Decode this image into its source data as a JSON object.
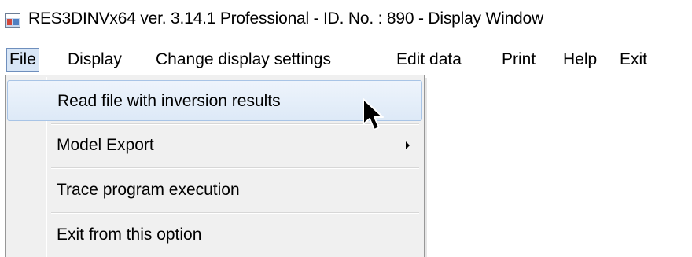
{
  "window": {
    "title": "RES3DINVx64 ver. 3.14.1 Professional - ID. No. : 890  - Display Window",
    "icon": "app-window-icon"
  },
  "menubar": {
    "items": [
      {
        "label": "File",
        "active": true
      },
      {
        "label": "Display",
        "active": false
      },
      {
        "label": "Change display settings",
        "active": false
      },
      {
        "label": "Edit data",
        "active": false
      },
      {
        "label": "Print",
        "active": false
      },
      {
        "label": "Help",
        "active": false
      },
      {
        "label": "Exit",
        "active": false
      }
    ]
  },
  "file_menu": {
    "items": [
      {
        "label": "Read file with inversion results",
        "highlighted": true,
        "has_submenu": false
      },
      {
        "label": "Model Export",
        "highlighted": false,
        "has_submenu": true
      },
      {
        "label": "Trace program execution",
        "highlighted": false,
        "has_submenu": false
      },
      {
        "label": "Exit from this option",
        "highlighted": false,
        "has_submenu": false
      }
    ]
  },
  "colors": {
    "menu_active_bg": "#d8e6f6",
    "menu_active_border": "#6f8fbd",
    "dropdown_bg": "#f0f0f0",
    "highlight_border": "#a8c4e6"
  }
}
